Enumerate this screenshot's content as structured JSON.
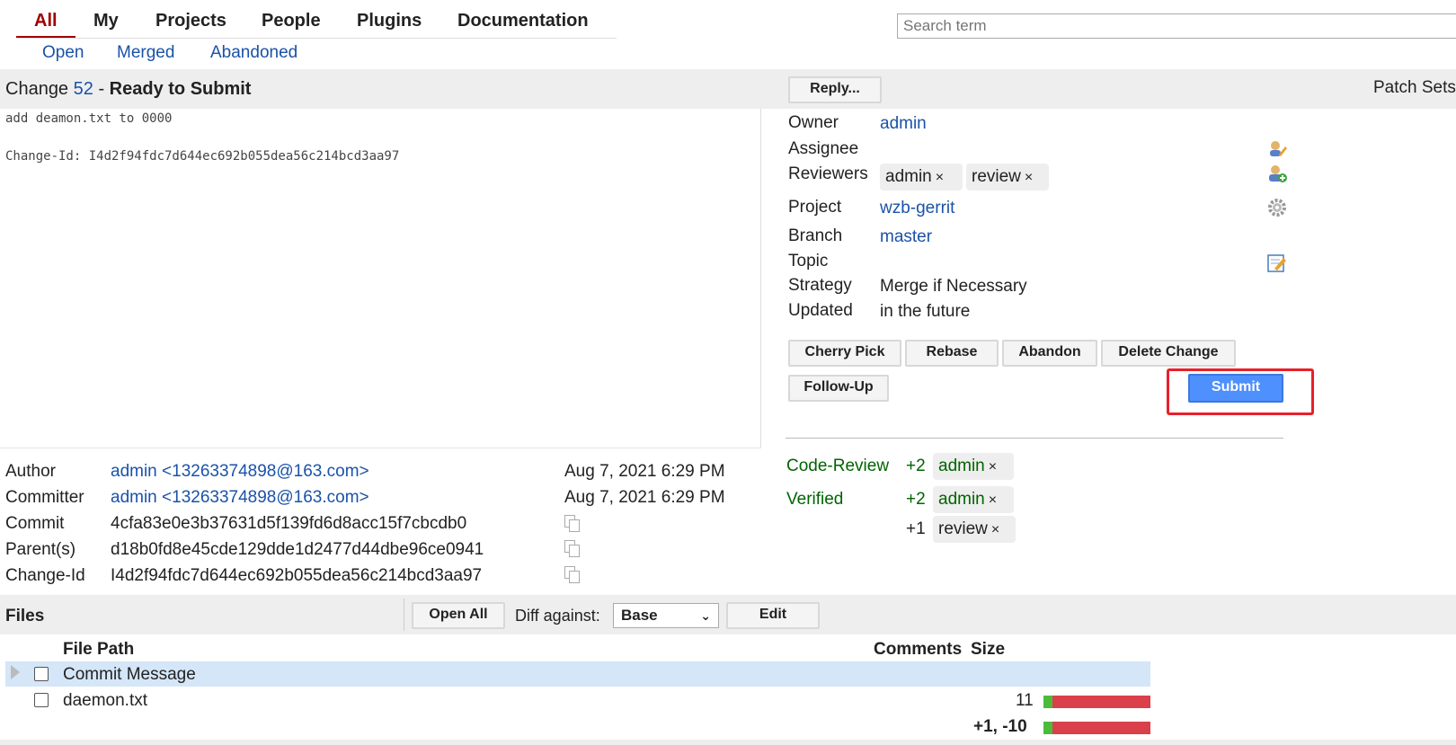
{
  "nav": {
    "tabs": [
      "All",
      "My",
      "Projects",
      "People",
      "Plugins",
      "Documentation"
    ],
    "subtabs": [
      "Open",
      "Merged",
      "Abandoned"
    ],
    "search_placeholder": "Search term"
  },
  "change": {
    "prefix": "Change",
    "number": "52",
    "separator": "-",
    "status": "Ready to Submit",
    "reply_label": "Reply...",
    "patch_sets_label": "Patch Sets",
    "message_line1": "add deamon.txt to 0000",
    "message_line2": "Change-Id: I4d2f94fdc7d644ec692b055dea56c214bcd3aa97"
  },
  "info": {
    "owner_label": "Owner",
    "owner": "admin",
    "assignee_label": "Assignee",
    "reviewers_label": "Reviewers",
    "reviewers": [
      "admin",
      "review"
    ],
    "remove_glyph": "×",
    "project_label": "Project",
    "project": "wzb-gerrit",
    "branch_label": "Branch",
    "branch": "master",
    "topic_label": "Topic",
    "strategy_label": "Strategy",
    "strategy": "Merge if Necessary",
    "updated_label": "Updated",
    "updated": "in the future"
  },
  "actions": {
    "cherry_pick": "Cherry Pick",
    "rebase": "Rebase",
    "abandon": "Abandon",
    "delete_change": "Delete Change",
    "follow_up": "Follow-Up",
    "submit": "Submit"
  },
  "labels": {
    "code_review": "Code-Review",
    "verified": "Verified",
    "votes": [
      {
        "score": "+2",
        "user": "admin"
      },
      {
        "score": "+2",
        "user": "admin"
      },
      {
        "score": "+1",
        "user": "review"
      }
    ]
  },
  "commit": {
    "author_label": "Author",
    "author": "admin <13263374898@163.com>",
    "author_date": "Aug 7, 2021 6:29 PM",
    "committer_label": "Committer",
    "committer": "admin <13263374898@163.com>",
    "committer_date": "Aug 7, 2021 6:29 PM",
    "commit_label": "Commit",
    "commit": "4cfa83e0e3b37631d5f139fd6d8acc15f7cbcdb0",
    "parent_label": "Parent(s)",
    "parent": "d18b0fd8e45cde129dde1d2477d44dbe96ce0941",
    "changeid_label": "Change-Id",
    "changeid": "I4d2f94fdc7d644ec692b055dea56c214bcd3aa97"
  },
  "files": {
    "title": "Files",
    "open_all": "Open All",
    "diff_against_label": "Diff against:",
    "diff_against_value": "Base",
    "edit": "Edit",
    "col_path": "File Path",
    "col_comments": "Comments",
    "col_size": "Size",
    "rows": [
      {
        "name": "Commit Message",
        "size": ""
      },
      {
        "name": "daemon.txt",
        "size": "11"
      }
    ],
    "total": "+1, -10"
  },
  "colors": {
    "highlight_box": "#e8202a",
    "submit_button": "#4d90fe",
    "active_tab": "#a00000",
    "link": "#1a52a8"
  }
}
